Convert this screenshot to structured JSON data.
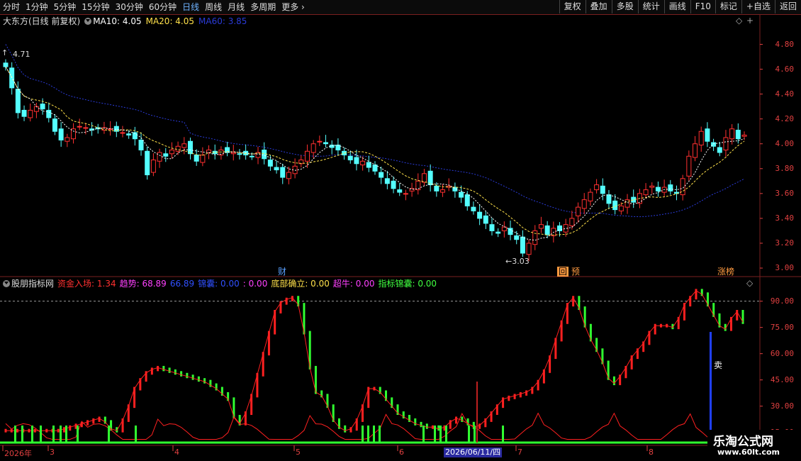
{
  "toolbar": {
    "periods": [
      "分时",
      "1分钟",
      "5分钟",
      "15分钟",
      "30分钟",
      "60分钟",
      "日线",
      "周线",
      "月线",
      "多周期",
      "更多 ›"
    ],
    "active_period": "日线",
    "right_buttons": [
      "复权",
      "叠加",
      "多股",
      "统计",
      "画线",
      "F10",
      "标记",
      "+自选",
      "返回"
    ]
  },
  "main_header": {
    "title": "大东方(日线 前复权)",
    "ma10_label": "MA10: 4.05",
    "ma20_label": "MA20: 4.05",
    "ma60_label": "MA60: 3.85"
  },
  "colors": {
    "up": "#ff3030",
    "down": "#54ffff",
    "ma10": "#ffffff",
    "ma20": "#ffe14a",
    "ma60": "#2a3bd8",
    "grid": "#7a1f1f",
    "axis_text": "#e04040"
  },
  "annotations": {
    "high_label": "4.71",
    "low_label": "←3.03",
    "tag_cai": "财",
    "tag_hui": "回",
    "tag_yu": "预",
    "tag_zhangbang": "涨榜",
    "sell_label": "卖",
    "date_label": "2026/06/11/四"
  },
  "indicator_header": {
    "name": "股朋指标网",
    "fund_in": "资金入场: 1.34",
    "trend": "趋势: 68.89",
    "trend2": "66.89",
    "jinnang": "锦囊: 0.00",
    "sep": ": 0.00",
    "bottom": "底部确立: 0.00",
    "super_bull": "超牛: 0.00",
    "indicator_jn": "指标锦囊: 0.00"
  },
  "watermark": {
    "line1": "乐淘公式网",
    "line2": "www.60lt.com"
  },
  "chart_data": [
    {
      "type": "candlestick",
      "title": "大东方(日线 前复权)",
      "y_ticks": [
        "4.80",
        "4.60",
        "4.40",
        "4.20",
        "4.00",
        "3.80",
        "3.60",
        "3.40",
        "3.20",
        "3.00"
      ],
      "ylim": [
        2.96,
        4.94
      ],
      "x_ticks": [
        "2026年",
        "3",
        "4",
        "5",
        "6",
        "7",
        "8"
      ],
      "high": 4.71,
      "low": 3.03,
      "close_series": [
        4.62,
        4.45,
        4.25,
        4.22,
        4.27,
        4.3,
        4.28,
        4.21,
        4.1,
        4.03,
        4.05,
        4.12,
        4.14,
        4.13,
        4.11,
        4.12,
        4.13,
        4.12,
        4.1,
        4.09,
        4.07,
        4.04,
        3.95,
        3.75,
        3.87,
        3.93,
        3.9,
        3.95,
        3.98,
        4.0,
        3.92,
        3.86,
        3.91,
        3.95,
        3.92,
        3.95,
        3.93,
        3.93,
        3.92,
        3.91,
        3.9,
        3.93,
        3.88,
        3.82,
        3.79,
        3.73,
        3.77,
        3.82,
        3.87,
        3.94,
        4.0,
        4.02,
        4.0,
        3.97,
        3.95,
        3.91,
        3.87,
        3.84,
        3.86,
        3.81,
        3.78,
        3.73,
        3.68,
        3.64,
        3.61,
        3.6,
        3.64,
        3.7,
        3.76,
        3.67,
        3.62,
        3.63,
        3.66,
        3.62,
        3.57,
        3.5,
        3.46,
        3.4,
        3.36,
        3.3,
        3.28,
        3.33,
        3.27,
        3.23,
        3.12,
        3.2,
        3.3,
        3.35,
        3.27,
        3.32,
        3.3,
        3.35,
        3.4,
        3.49,
        3.55,
        3.61,
        3.67,
        3.6,
        3.52,
        3.47,
        3.5,
        3.55,
        3.53,
        3.6,
        3.63,
        3.66,
        3.62,
        3.65,
        3.62,
        3.6,
        3.72,
        3.9,
        4.0,
        4.1,
        4.02,
        3.98,
        3.93,
        4.05,
        4.12,
        4.04,
        4.07
      ],
      "series": [
        {
          "name": "MA10",
          "value": 4.05
        },
        {
          "name": "MA20",
          "value": 4.05
        },
        {
          "name": "MA60",
          "value": 3.85
        }
      ]
    },
    {
      "type": "bar",
      "title": "股朋指标网",
      "y_ticks": [
        "90.00",
        "75.00",
        "60.00",
        "45.00",
        "30.00",
        "15.00"
      ],
      "ylim": [
        10,
        100
      ],
      "reference_line": 90,
      "trend_series": [
        16,
        16,
        16,
        16,
        16,
        16,
        16,
        16,
        16,
        16,
        17,
        18,
        19,
        20,
        21,
        22,
        23,
        21,
        17,
        16,
        22,
        30,
        40,
        45,
        49,
        51,
        52,
        51,
        50,
        49,
        48,
        47,
        46,
        45,
        44,
        42,
        40,
        37,
        34,
        24,
        20,
        26,
        36,
        48,
        60,
        72,
        84,
        89,
        91,
        92,
        88,
        72,
        52,
        38,
        36,
        30,
        22,
        18,
        16,
        17,
        22,
        30,
        40,
        40,
        38,
        34,
        30,
        26,
        24,
        22,
        20,
        19,
        18,
        18,
        17,
        18,
        21,
        23,
        22,
        20,
        18,
        19,
        22,
        26,
        30,
        34,
        35,
        36,
        37,
        38,
        40,
        44,
        50,
        58,
        68,
        78,
        88,
        92,
        86,
        76,
        68,
        62,
        55,
        46,
        43,
        47,
        52,
        58,
        62,
        66,
        72,
        76,
        76,
        76,
        75,
        80,
        88,
        92,
        96,
        94,
        88,
        82,
        76,
        74,
        80,
        84,
        78
      ]
    }
  ]
}
